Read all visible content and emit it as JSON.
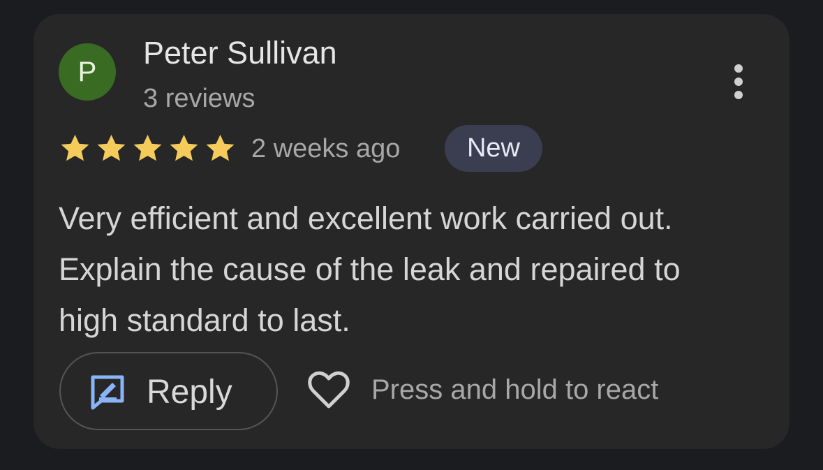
{
  "review": {
    "avatar_initial": "P",
    "author_name": "Peter Sullivan",
    "review_count": "3 reviews",
    "rating": 5,
    "rating_max": 5,
    "time_ago": "2 weeks ago",
    "badge": "New",
    "text": "Very efficient and excellent work carried out. Explain the cause of the leak and repaired to high standard to last."
  },
  "actions": {
    "reply_label": "Reply",
    "react_hint": "Press and hold to react"
  },
  "icons": {
    "more": "more-vert-icon",
    "star": "star-icon",
    "reply": "reply-icon",
    "heart": "heart-outline-icon"
  },
  "colors": {
    "background": "#1b1c1f",
    "card": "#272727",
    "avatar": "#3a6b22",
    "star": "#f5cb5c",
    "badge": "#3b3e50",
    "reply_icon": "#8ab4f8"
  }
}
